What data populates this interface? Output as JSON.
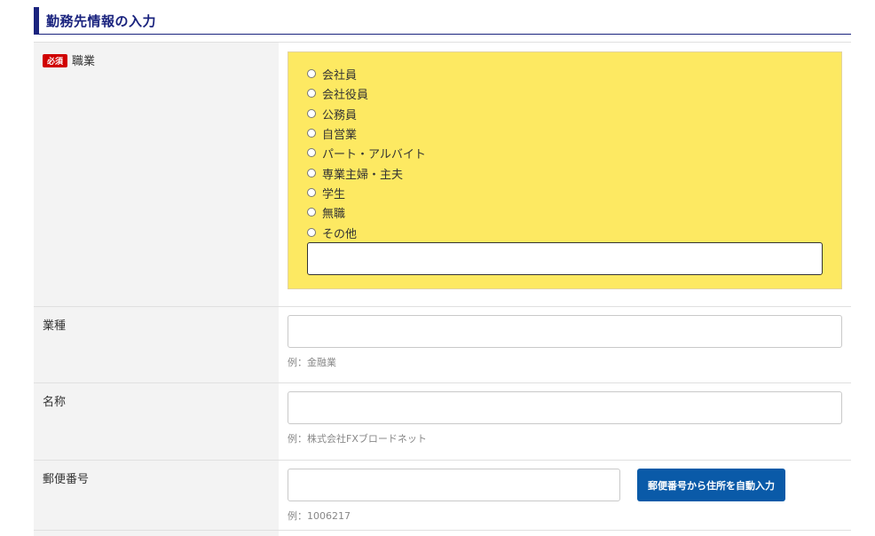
{
  "section": {
    "title": "勤務先情報の入力"
  },
  "occupation": {
    "required_badge": "必須",
    "label": "職業",
    "options": [
      "会社員",
      "会社役員",
      "公務員",
      "自営業",
      "パート・アルバイト",
      "専業主婦・主夫",
      "学生",
      "無職",
      "その他"
    ],
    "other_value": ""
  },
  "industry": {
    "label": "業種",
    "value": "",
    "hint": "例：金融業"
  },
  "company_name": {
    "label": "名称",
    "value": "",
    "hint": "例：株式会社FXブロードネット"
  },
  "postal_code": {
    "label": "郵便番号",
    "value": "",
    "hint": "例：1006217",
    "autofill_button": "郵便番号から住所を自動入力"
  },
  "colors": {
    "header_accent": "#1a237e",
    "option_box_bg": "#fde962",
    "required_badge": "#d00000",
    "button_bg": "#0a5aa8",
    "label_cell_bg": "#f3f3f3"
  }
}
